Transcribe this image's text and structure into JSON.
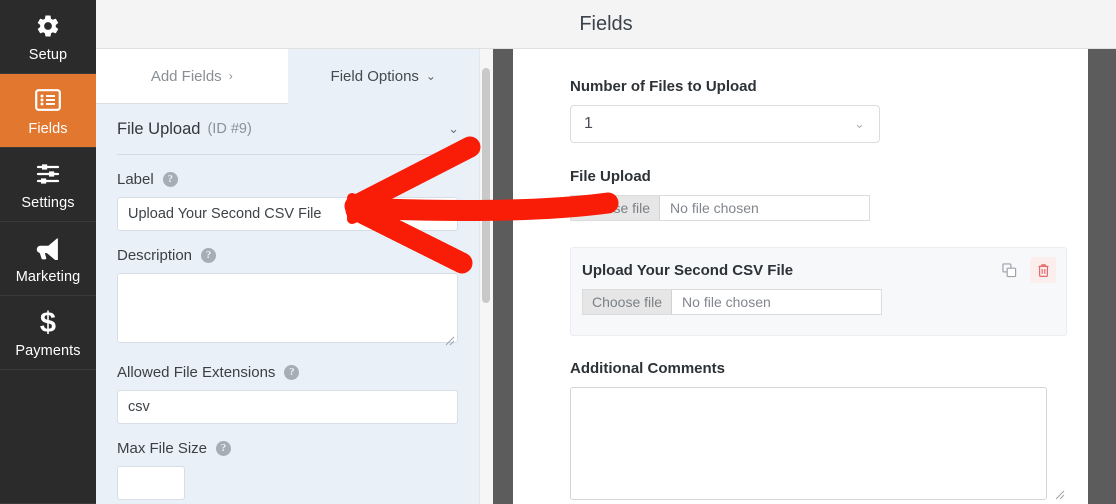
{
  "sidebar": {
    "items": [
      {
        "label": "Setup",
        "icon": "gear-icon",
        "active": false
      },
      {
        "label": "Fields",
        "icon": "list-icon",
        "active": true
      },
      {
        "label": "Settings",
        "icon": "sliders-icon",
        "active": false
      },
      {
        "label": "Marketing",
        "icon": "megaphone-icon",
        "active": false
      },
      {
        "label": "Payments",
        "icon": "dollar-icon",
        "active": false
      }
    ]
  },
  "header": {
    "title": "Fields"
  },
  "edit_panel": {
    "tabs": [
      {
        "label": "Add Fields",
        "caret": "›",
        "active": false
      },
      {
        "label": "Field Options",
        "caret": "⌄",
        "active": true
      }
    ],
    "field_header": {
      "title": "File Upload",
      "id": "(ID #9)",
      "caret": "⌄"
    },
    "fields": [
      {
        "label": "Label",
        "help": "?",
        "type": "text",
        "value": "Upload Your Second CSV File",
        "placeholder": ""
      },
      {
        "label": "Description",
        "help": "?",
        "type": "textarea",
        "value": "",
        "placeholder": ""
      },
      {
        "label": "Allowed File Extensions",
        "help": "?",
        "type": "text",
        "value": "csv",
        "placeholder": ""
      },
      {
        "label": "Max File Size",
        "help": "?",
        "type": "text-small",
        "value": "",
        "placeholder": ""
      }
    ]
  },
  "preview": {
    "number_of_files": {
      "label": "Number of Files to Upload",
      "value": "1",
      "caret": "⌄",
      "options": [
        "1"
      ]
    },
    "file_upload": {
      "label": "File Upload",
      "button_label": "Choose file",
      "status": "No file chosen"
    },
    "selected_field": {
      "label": "Upload Your Second CSV File",
      "button_label": "Choose file",
      "status": "No file chosen",
      "duplicate_icon": "duplicate-icon",
      "delete_icon": "trash-icon"
    },
    "additional_comments": {
      "label": "Additional Comments",
      "value": ""
    }
  },
  "annotation": {
    "type": "red-arrow",
    "color": "#f91c07",
    "points_to": "label-input"
  },
  "colors": {
    "sidebar_bg": "#2b2b2b",
    "sidebar_active": "#e27730",
    "panel_bg": "#e9f0f8",
    "gutter": "#5c5c5c",
    "accent_red": "#f91c07",
    "trash_red": "#e46a6a"
  }
}
